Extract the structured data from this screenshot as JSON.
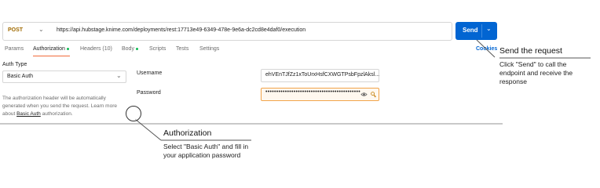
{
  "request": {
    "method": "POST",
    "url": "https://api.hubstage.knime.com/deployments/rest:17713e49-6349-478e-9e6a-dc2cd8e4daf0/execution",
    "send_label": "Send"
  },
  "tabs": [
    {
      "label": "Params"
    },
    {
      "label": "Authorization"
    },
    {
      "label": "Headers (10)"
    },
    {
      "label": "Body"
    },
    {
      "label": "Scripts"
    },
    {
      "label": "Tests"
    },
    {
      "label": "Settings"
    }
  ],
  "cookies_label": "Cookies",
  "auth": {
    "type_label": "Auth Type",
    "type_value": "Basic Auth",
    "description_part1": "The authorization header will be automatically generated when you send the request. Learn more about ",
    "description_link": "Basic Auth",
    "description_part2": " authorization.",
    "username_label": "Username",
    "username_value": "ehVEnTJfZz1xToUrxHsfCXWGTPsbFpzlAksl...",
    "password_label": "Password",
    "password_value": "••••••••••••••••••••••••••••••••••••••••••••"
  },
  "callouts": {
    "send": {
      "title": "Send the request",
      "text": "Click \"Send\" to call the endpoint and receive the response"
    },
    "auth": {
      "title": "Authorization",
      "text": "Select \"Basic Auth\" and fill in your application password"
    }
  },
  "colors": {
    "accent": "#0265d2",
    "active_tab": "#f26b3a",
    "status_dot": "#0cbb52",
    "method": "#a06a00"
  },
  "icons": [
    "chevron-down-icon",
    "eye-icon",
    "key-icon"
  ]
}
